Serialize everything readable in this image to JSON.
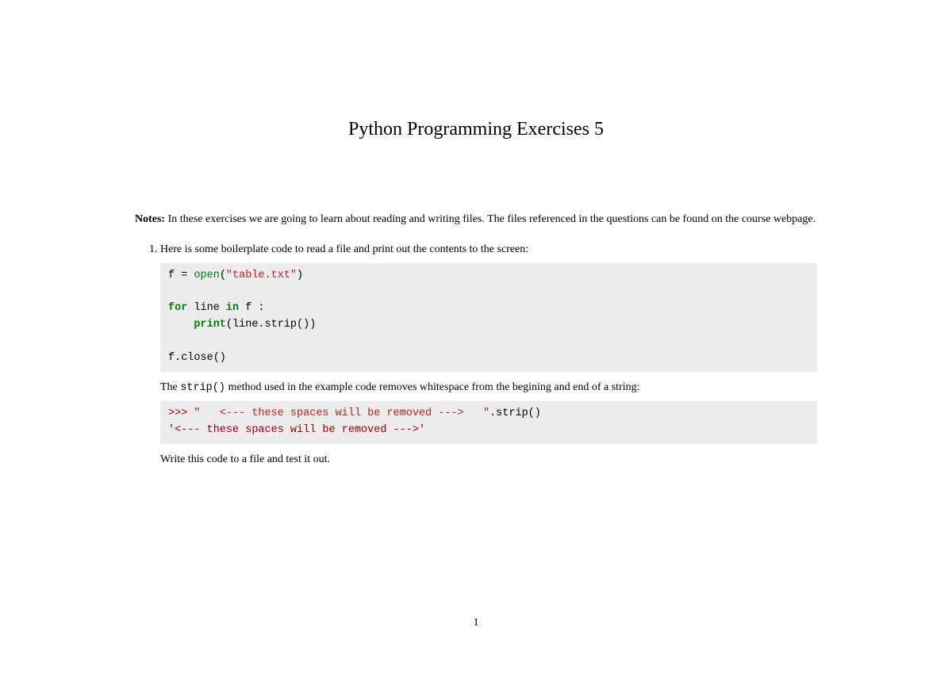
{
  "title": "Python Programming Exercises 5",
  "notes": {
    "label": "Notes:",
    "text": " In these exercises we are going to learn about reading and writing files. The files referenced in the questions can be found on the course webpage."
  },
  "exercise1": {
    "intro": "Here is some boilerplate code to read a file and print out the contents to the screen:",
    "code1": {
      "l1_id": "f ",
      "l1_op": "= ",
      "l1_fn": "open",
      "l1_paren_o": "(",
      "l1_str": "\"table.txt\"",
      "l1_paren_c": ")",
      "l3_kw": "for",
      "l3_rest": " line ",
      "l3_in": "in",
      "l3_f": " f :",
      "l4_indent": "    ",
      "l4_fn": "print",
      "l4_args": "(line.strip())",
      "l6": "f.close()"
    },
    "mid_pre": "The ",
    "mid_code": "strip()",
    "mid_post": " method used in the example code removes whitespace from the begining and end of a string:",
    "code2": {
      "prompt": ">>> ",
      "q1": "\"   ",
      "body": "<--- these spaces will be removed --->   ",
      "q2": "\"",
      "call": ".strip()",
      "out": "'<--- these spaces will be removed --->'"
    },
    "closing": "Write this code to a file and test it out."
  },
  "page_number": "1"
}
